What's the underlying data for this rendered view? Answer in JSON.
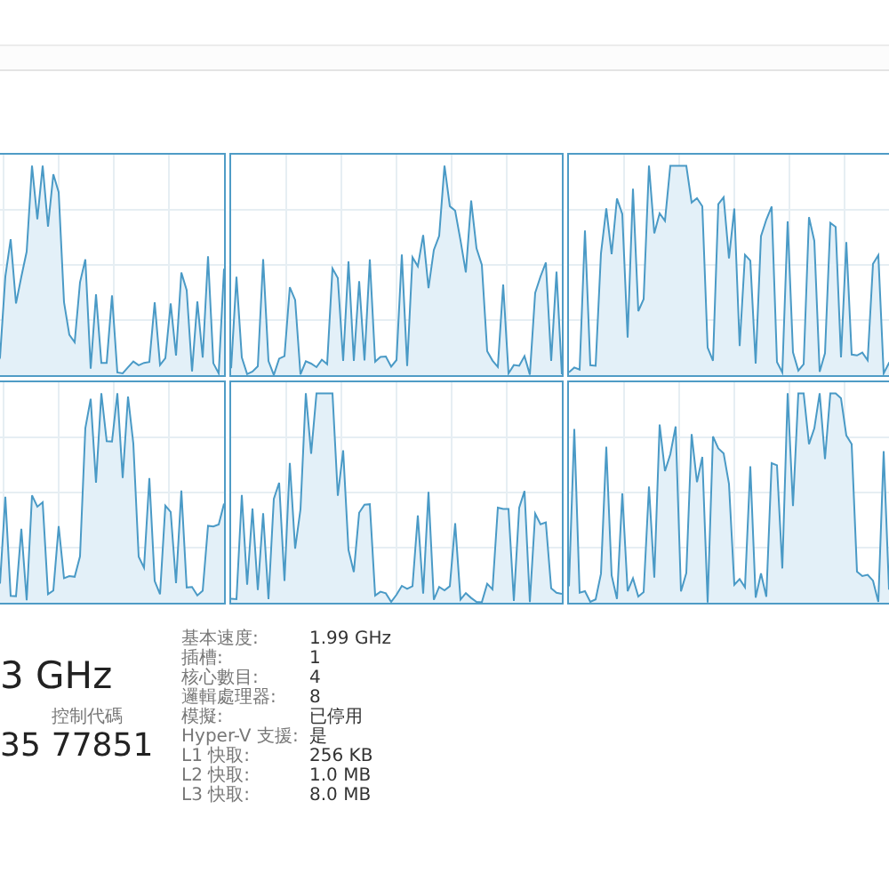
{
  "core_graphs": [
    {
      "kind": "sparkline"
    },
    {
      "kind": "sparkline"
    },
    {
      "kind": "sparkline"
    },
    {
      "kind": "sparkline"
    },
    {
      "kind": "sparkline"
    },
    {
      "kind": "sparkline"
    }
  ],
  "speed": "3 GHz",
  "handles": {
    "label": "控制代碼",
    "value": "77851"
  },
  "threads_value": "35",
  "details": [
    {
      "label": "基本速度:",
      "value": "1.99 GHz"
    },
    {
      "label": "插槽:",
      "value": "1"
    },
    {
      "label": "核心數目:",
      "value": "4"
    },
    {
      "label": "邏輯處理器:",
      "value": "8"
    },
    {
      "label": "模擬:",
      "value": "已停用"
    },
    {
      "label": "Hyper-V 支援:",
      "value": "是"
    },
    {
      "label": "L1 快取:",
      "value": "256 KB"
    },
    {
      "label": "L2 快取:",
      "value": "1.0 MB"
    },
    {
      "label": "L3 快取:",
      "value": "8.0 MB"
    }
  ]
}
